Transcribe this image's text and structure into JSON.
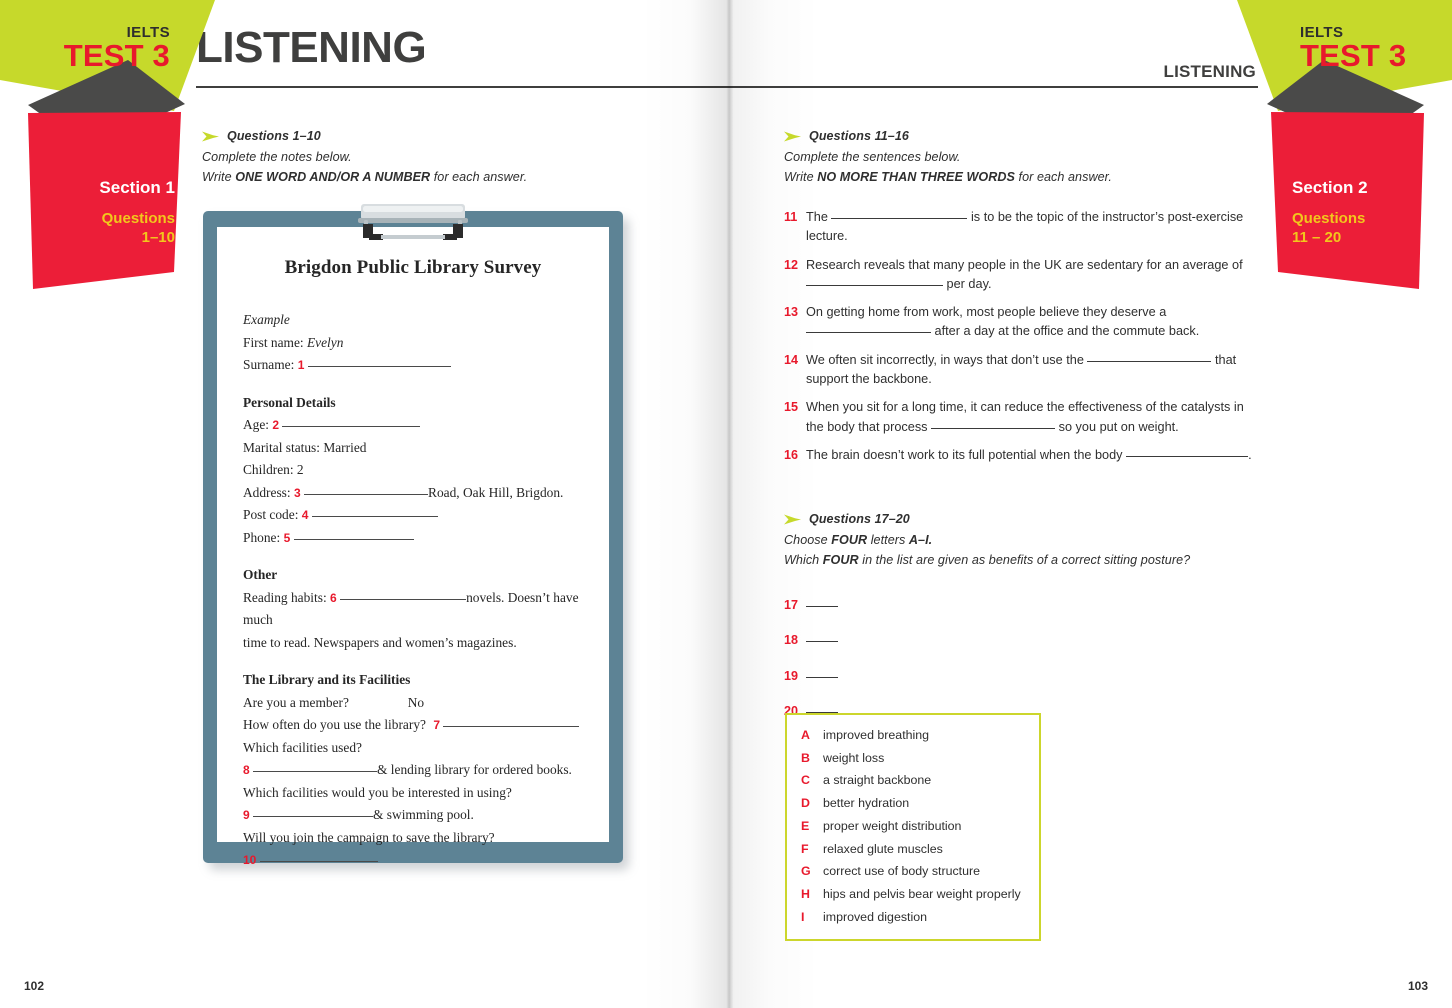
{
  "colors": {
    "green": "#c6d92b",
    "red": "#e8192c",
    "dark_gray": "#4a4a49",
    "gold": "#f2c71c",
    "clipboard_border": "#5d8395",
    "text": "#2f2f2f"
  },
  "left_page": {
    "page_number": "102",
    "header_title": "LISTENING",
    "banner": {
      "ielts": "IELTS",
      "test": "TEST 3",
      "section": "Section 1",
      "questions_label": "Questions",
      "questions_range": "1–10"
    },
    "instructions": {
      "heading": "Questions 1–10",
      "line1": "Complete the notes below.",
      "line2_pre": "Write ",
      "line2_bold": "ONE WORD AND/OR A NUMBER",
      "line2_post": " for each answer."
    },
    "clipboard": {
      "title": "Brigdon Public Library Survey",
      "example_label": "Example",
      "first_name_label": "First name:",
      "first_name_value": "Evelyn",
      "surname_label": "Surname:",
      "surname_q": "1",
      "personal_details_heading": "Personal Details",
      "age_label": "Age:",
      "age_q": "2",
      "marital_status": "Marital status: Married",
      "children": "Children: 2",
      "address_label": "Address:",
      "address_q": "3",
      "address_suffix": "Road, Oak Hill, Brigdon.",
      "post_code_label": "Post code:",
      "post_code_q": "4",
      "phone_label": "Phone:",
      "phone_q": "5",
      "other_heading": "Other",
      "reading_habits_label": "Reading habits:",
      "reading_habits_q": "6",
      "reading_habits_suffix": "novels. Doesn’t have much",
      "reading_habits_line2": "time to read. Newspapers and women’s magazines.",
      "library_heading": "The Library and its Facilities",
      "member_question": "Are you a member?",
      "member_answer": "No",
      "how_often_question": "How often do you use the library?",
      "how_often_q": "7",
      "which_used_question": "Which facilities used?",
      "q8": "8",
      "q8_suffix": "& lending library for ordered books.",
      "which_interested_question": "Which facilities would you be interested in using?",
      "q9": "9",
      "q9_suffix": "& swimming pool.",
      "campaign_question": "Will you join the campaign to save the library?",
      "q10": "10"
    }
  },
  "right_page": {
    "page_number": "103",
    "header_title": "LISTENING",
    "banner": {
      "ielts": "IELTS",
      "test": "TEST 3",
      "section": "Section 2",
      "questions_label": "Questions",
      "questions_range": "11 – 20"
    },
    "instructions_1": {
      "heading": "Questions 11–16",
      "line1": "Complete the sentences below.",
      "line2_pre": "Write ",
      "line2_bold": "NO MORE THAN THREE WORDS",
      "line2_post": " for each answer."
    },
    "questions_11_16": [
      {
        "num": "11",
        "pre": "The ",
        "blank": 1,
        "post": " is to be the topic of the instructor’s post-exercise lecture."
      },
      {
        "num": "12",
        "pre": "Research reveals that many people in the UK are sedentary for an average of ",
        "blank": 1,
        "post": " per day."
      },
      {
        "num": "13",
        "pre": "On getting home from work, most people believe they deserve a ",
        "blank": 1,
        "post": " after a day at the office and the commute back."
      },
      {
        "num": "14",
        "pre": "We often sit incorrectly, in ways that don’t use the ",
        "blank": 1,
        "post": " that support the backbone."
      },
      {
        "num": "15",
        "pre": "When you sit for a long time, it can reduce the effectiveness of the catalysts in the body that process ",
        "blank": 1,
        "post": " so you put on weight."
      },
      {
        "num": "16",
        "pre": "The brain doesn’t work to its full potential when the body ",
        "blank": 1,
        "post": "."
      }
    ],
    "instructions_2": {
      "heading": "Questions 17–20",
      "line1_pre": "Choose ",
      "line1_bold": "FOUR",
      "line1_mid": " letters ",
      "line1_bold2": "A–I.",
      "line2_pre": "Which ",
      "line2_bold": "FOUR",
      "line2_post": " in the list are given as benefits of a correct sitting posture?"
    },
    "answer_slots": [
      "17",
      "18",
      "19",
      "20"
    ],
    "options": [
      {
        "letter": "A",
        "text": "improved breathing"
      },
      {
        "letter": "B",
        "text": "weight loss"
      },
      {
        "letter": "C",
        "text": "a straight backbone"
      },
      {
        "letter": "D",
        "text": "better hydration"
      },
      {
        "letter": "E",
        "text": "proper weight distribution"
      },
      {
        "letter": "F",
        "text": "relaxed glute muscles"
      },
      {
        "letter": "G",
        "text": "correct use of body structure"
      },
      {
        "letter": "H",
        "text": "hips and pelvis bear weight properly"
      },
      {
        "letter": "I",
        "text": "improved digestion"
      }
    ]
  }
}
